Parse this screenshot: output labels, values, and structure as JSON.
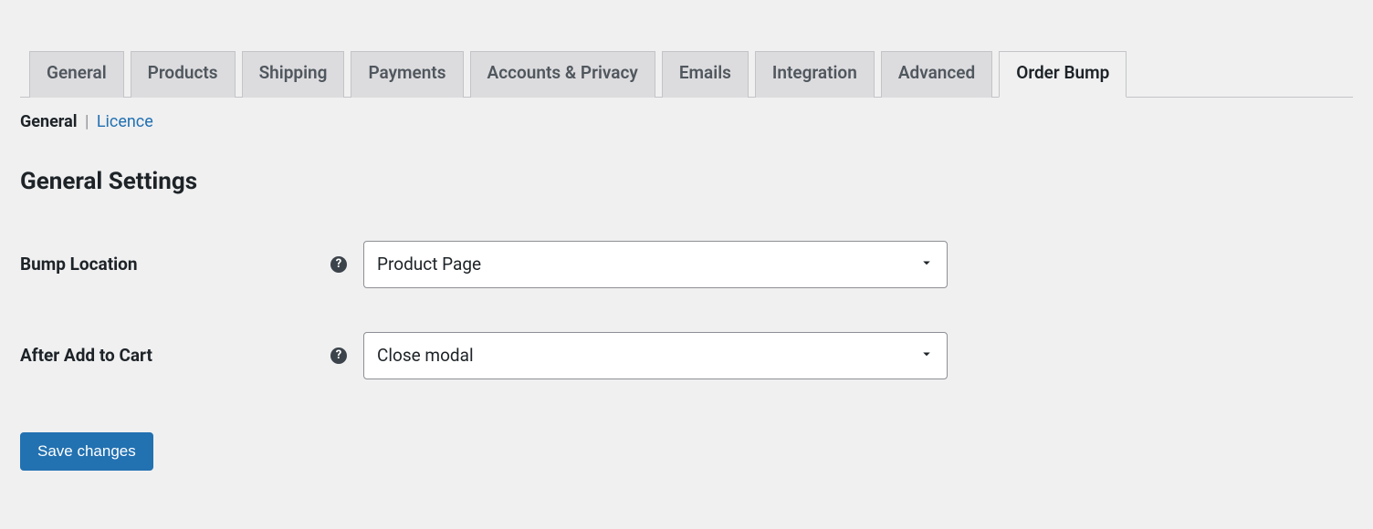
{
  "tabs": [
    {
      "label": "General",
      "active": false
    },
    {
      "label": "Products",
      "active": false
    },
    {
      "label": "Shipping",
      "active": false
    },
    {
      "label": "Payments",
      "active": false
    },
    {
      "label": "Accounts & Privacy",
      "active": false
    },
    {
      "label": "Emails",
      "active": false
    },
    {
      "label": "Integration",
      "active": false
    },
    {
      "label": "Advanced",
      "active": false
    },
    {
      "label": "Order Bump",
      "active": true
    }
  ],
  "subtabs": {
    "current": "General",
    "link": "Licence"
  },
  "section_title": "General Settings",
  "fields": {
    "bump_location": {
      "label": "Bump Location",
      "value": "Product Page"
    },
    "after_add_to_cart": {
      "label": "After Add to Cart",
      "value": "Close modal"
    }
  },
  "save_button": "Save changes"
}
